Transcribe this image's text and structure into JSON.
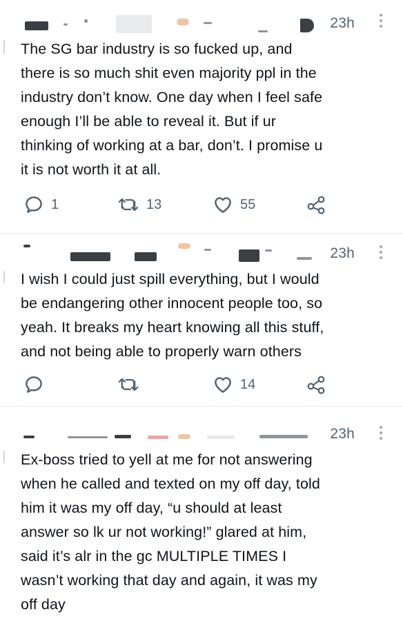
{
  "tweets": [
    {
      "time": "23h",
      "text": "The SG bar industry is so fucked up, and\nthere is so much shit even majority ppl in the\nindustry don’t know. One day when I feel safe\nenough I’ll be able to reveal it. But if ur\nthinking of working at a bar, don’t. I promise u\nit is not worth it at all.",
      "replies": "1",
      "retweets": "13",
      "likes": "55"
    },
    {
      "time": "23h",
      "text": "I wish I could just spill everything, but I would\nbe endangering other innocent people too, so\nyeah. It breaks my heart knowing all this stuff,\nand not being able to properly warn others",
      "replies": "",
      "retweets": "",
      "likes": "14"
    },
    {
      "time": "23h",
      "text": "Ex-boss tried to yell at me for not answering\nwhen he called and texted on my off day, told\nhim it was my off day, “u should at least\nanswer so lk ur not working!” glared at him,\nsaid it’s alr in the gc MULTIPLE TIMES I\nwasn’t working that day and again, it was my\noff day"
    }
  ],
  "icons": {
    "reply": "reply-icon",
    "retweet": "retweet-icon",
    "like": "heart-icon",
    "share": "share-icon",
    "more": "more-icon"
  },
  "colors": {
    "text": "#0f1419",
    "secondary": "#536471",
    "divider": "#e6e9eb"
  }
}
